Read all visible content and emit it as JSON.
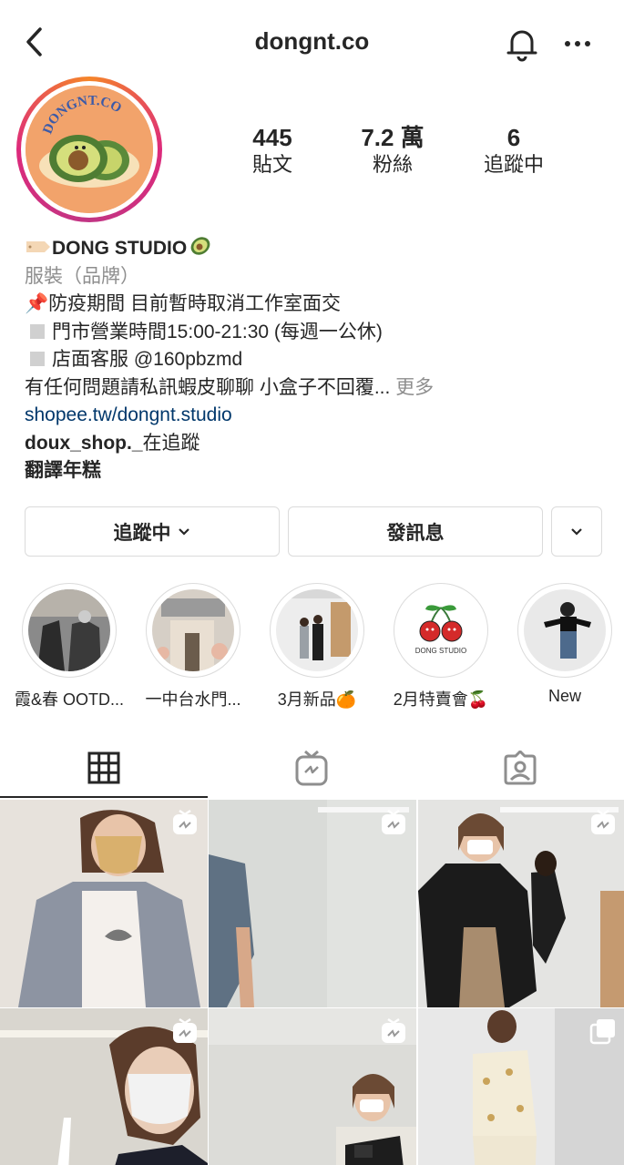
{
  "header": {
    "username": "dongnt.co",
    "icons": [
      "chevron-left-icon",
      "bell-icon",
      "more-icon"
    ]
  },
  "stats": [
    {
      "value": "445",
      "label": "貼文"
    },
    {
      "value": "7.2 萬",
      "label": "粉絲"
    },
    {
      "value": "6",
      "label": "追蹤中"
    }
  ],
  "bio": {
    "name": "DONG STUDIO",
    "category": "服裝（品牌）",
    "line1": "📌防疫期間 目前暫時取消工作室面交",
    "line2": "門市營業時間15:00-21:30 (每週一公休)",
    "line3": "店面客服 @160pbzmd",
    "line4": "有任何問題請私訊蝦皮聊聊 小盒子不回覆...",
    "more": "更多",
    "link": "shopee.tw/dongnt.studio",
    "followed_by_user": "doux_shop._",
    "followed_by_suffix": "在追蹤",
    "translate": "翻譯年糕"
  },
  "avatar_logo_text": "DONGNT.CO",
  "buttons": {
    "following": "追蹤中",
    "message": "發訊息"
  },
  "highlights": [
    {
      "label": "霞&春 OOTD..."
    },
    {
      "label": "一中台水門..."
    },
    {
      "label": "3月新品🍊"
    },
    {
      "label": "2月特賣會🍒"
    },
    {
      "label": "New"
    }
  ],
  "highlight_inline_text": {
    "cherry_logo": "DONG STUDIO"
  },
  "tabs": [
    "grid-icon",
    "igtv-icon",
    "tagged-icon"
  ],
  "colors": {
    "link": "#00376b",
    "secondary_text": "#8e8e8e",
    "border": "#dbdbdb",
    "story_ring_start": "#f58529",
    "story_ring_end": "#c13584"
  }
}
